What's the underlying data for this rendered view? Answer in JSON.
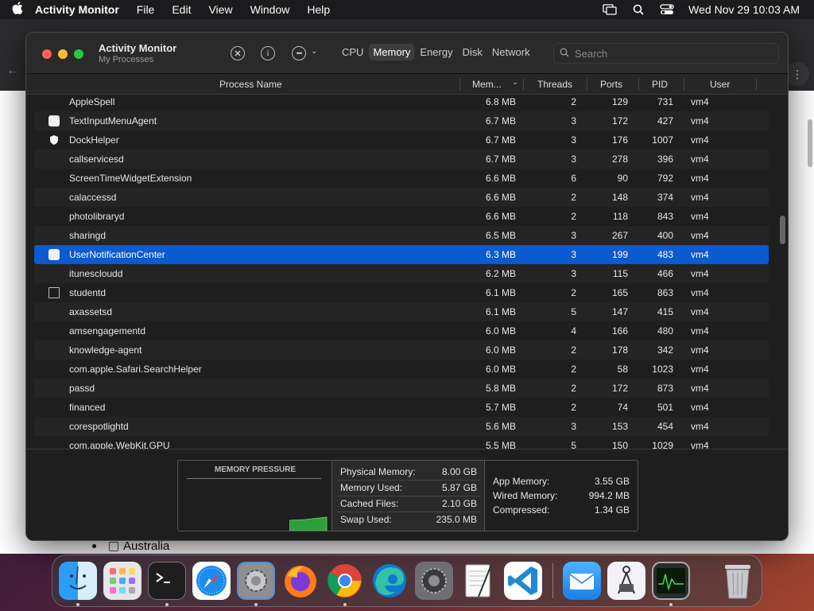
{
  "menubar": {
    "app_name": "Activity Monitor",
    "menus": [
      "File",
      "Edit",
      "View",
      "Window",
      "Help"
    ],
    "datetime": "Wed Nov 29  10:03 AM"
  },
  "background": {
    "list_item": "Australia"
  },
  "window": {
    "title": "Activity Monitor",
    "subtitle": "My Processes",
    "tabs": [
      "CPU",
      "Memory",
      "Energy",
      "Disk",
      "Network"
    ],
    "active_tab": "Memory",
    "search_placeholder": "Search"
  },
  "columns": {
    "name": "Process Name",
    "mem": "Mem...",
    "threads": "Threads",
    "ports": "Ports",
    "pid": "PID",
    "user": "User"
  },
  "processes": [
    {
      "name": "AppleSpell",
      "mem": "6.8 MB",
      "threads": "2",
      "ports": "129",
      "pid": "731",
      "user": "vm4",
      "icon": "none"
    },
    {
      "name": "TextInputMenuAgent",
      "mem": "6.7 MB",
      "threads": "3",
      "ports": "172",
      "pid": "427",
      "user": "vm4",
      "icon": "white"
    },
    {
      "name": "DockHelper",
      "mem": "6.7 MB",
      "threads": "3",
      "ports": "176",
      "pid": "1007",
      "user": "vm4",
      "icon": "shield"
    },
    {
      "name": "callservicesd",
      "mem": "6.7 MB",
      "threads": "3",
      "ports": "278",
      "pid": "396",
      "user": "vm4",
      "icon": "none"
    },
    {
      "name": "ScreenTimeWidgetExtension",
      "mem": "6.6 MB",
      "threads": "6",
      "ports": "90",
      "pid": "792",
      "user": "vm4",
      "icon": "none"
    },
    {
      "name": "calaccessd",
      "mem": "6.6 MB",
      "threads": "2",
      "ports": "148",
      "pid": "374",
      "user": "vm4",
      "icon": "none"
    },
    {
      "name": "photolibraryd",
      "mem": "6.6 MB",
      "threads": "2",
      "ports": "118",
      "pid": "843",
      "user": "vm4",
      "icon": "none"
    },
    {
      "name": "sharingd",
      "mem": "6.5 MB",
      "threads": "3",
      "ports": "267",
      "pid": "400",
      "user": "vm4",
      "icon": "none"
    },
    {
      "name": "UserNotificationCenter",
      "mem": "6.3 MB",
      "threads": "3",
      "ports": "199",
      "pid": "483",
      "user": "vm4",
      "icon": "white",
      "selected": true
    },
    {
      "name": "itunescloudd",
      "mem": "6.2 MB",
      "threads": "3",
      "ports": "115",
      "pid": "466",
      "user": "vm4",
      "icon": "none"
    },
    {
      "name": "studentd",
      "mem": "6.1 MB",
      "threads": "2",
      "ports": "165",
      "pid": "863",
      "user": "vm4",
      "icon": "outline"
    },
    {
      "name": "axassetsd",
      "mem": "6.1 MB",
      "threads": "5",
      "ports": "147",
      "pid": "415",
      "user": "vm4",
      "icon": "none"
    },
    {
      "name": "amsengagementd",
      "mem": "6.0 MB",
      "threads": "4",
      "ports": "166",
      "pid": "480",
      "user": "vm4",
      "icon": "none"
    },
    {
      "name": "knowledge-agent",
      "mem": "6.0 MB",
      "threads": "2",
      "ports": "178",
      "pid": "342",
      "user": "vm4",
      "icon": "none"
    },
    {
      "name": "com.apple.Safari.SearchHelper",
      "mem": "6.0 MB",
      "threads": "2",
      "ports": "58",
      "pid": "1023",
      "user": "vm4",
      "icon": "none"
    },
    {
      "name": "passd",
      "mem": "5.8 MB",
      "threads": "2",
      "ports": "172",
      "pid": "873",
      "user": "vm4",
      "icon": "none"
    },
    {
      "name": "financed",
      "mem": "5.7 MB",
      "threads": "2",
      "ports": "74",
      "pid": "501",
      "user": "vm4",
      "icon": "none"
    },
    {
      "name": "corespotlightd",
      "mem": "5.6 MB",
      "threads": "3",
      "ports": "153",
      "pid": "454",
      "user": "vm4",
      "icon": "none"
    },
    {
      "name": "com.apple.WebKit.GPU",
      "mem": "5.5 MB",
      "threads": "5",
      "ports": "150",
      "pid": "1029",
      "user": "vm4",
      "icon": "none"
    }
  ],
  "memory": {
    "pressure_title": "MEMORY PRESSURE",
    "pressure_color": "#2e9e3a",
    "stats_left": [
      {
        "label": "Physical Memory:",
        "value": "8.00 GB"
      },
      {
        "label": "Memory Used:",
        "value": "5.87 GB"
      },
      {
        "label": "Cached Files:",
        "value": "2.10 GB"
      },
      {
        "label": "Swap Used:",
        "value": "235.0 MB"
      }
    ],
    "stats_right": [
      {
        "label": "App Memory:",
        "value": "3.55 GB"
      },
      {
        "label": "Wired Memory:",
        "value": "994.2 MB"
      },
      {
        "label": "Compressed:",
        "value": "1.34 GB"
      }
    ]
  },
  "dock": {
    "apps": [
      "finder-icon",
      "launchpad-icon",
      "terminal-icon",
      "safari-icon",
      "system-preferences-icon",
      "firefox-icon",
      "chrome-icon",
      "edge-icon",
      "system-settings-icon",
      "textedit-icon",
      "vscode-icon",
      "mail-icon",
      "screenshot-icon",
      "activity-monitor-icon",
      "trash-icon"
    ]
  }
}
